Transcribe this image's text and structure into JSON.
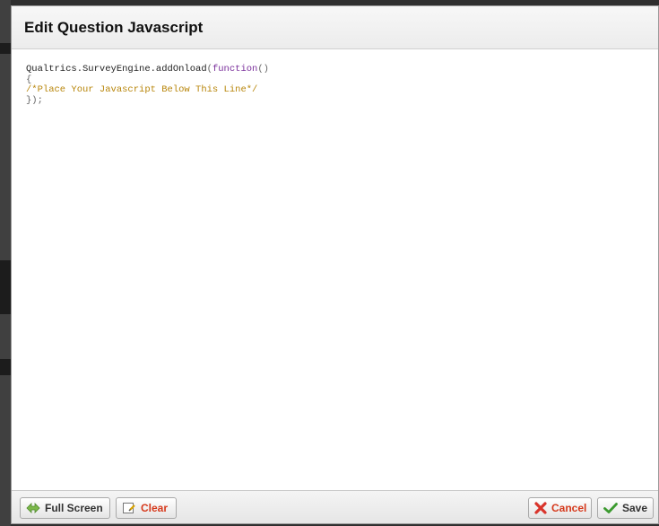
{
  "dialog": {
    "title": "Edit Question Javascript"
  },
  "editor": {
    "line1": {
      "object": "Qualtrics.SurveyEngine.addOnload",
      "open_paren": "(",
      "keyword": "function",
      "parens": "()"
    },
    "line2": "{",
    "line3": "/*Place Your Javascript Below This Line*/",
    "line4": "});"
  },
  "footer": {
    "fullscreen_label": "Full Screen",
    "clear_label": "Clear",
    "cancel_label": "Cancel",
    "save_label": "Save"
  },
  "icons": {
    "fullscreen": "arrows-expand-icon",
    "clear": "clear-document-icon",
    "cancel": "x-cross-icon",
    "save": "checkmark-icon"
  },
  "colors": {
    "keyword": "#7a2f9b",
    "comment": "#b8860b",
    "danger": "#d63a1d",
    "success": "#3b9a2f"
  }
}
